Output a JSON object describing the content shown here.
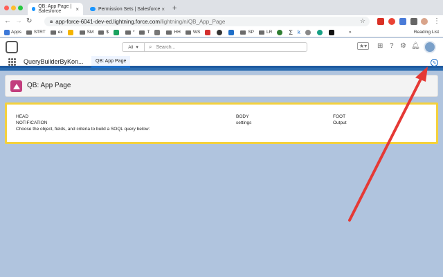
{
  "browser": {
    "tabs": [
      {
        "title": "QB: App Page | Salesforce",
        "active": true
      },
      {
        "title": "Permission Sets | Salesforce",
        "active": false
      }
    ],
    "url_host": "app-force-6041-dev-ed.lightning.force.com",
    "url_path": "/lightning/n/QB_App_Page",
    "bookmarks": [
      "Apps",
      "STRT",
      "ex",
      "SM",
      "$",
      "*",
      "T",
      "HH",
      "WS",
      "SP",
      "LR",
      "Σ",
      "k",
      "»"
    ],
    "reading_list": "Reading List"
  },
  "sf": {
    "search_scope": "All",
    "search_placeholder": "Search...",
    "app_name": "QueryBuilderByKon...",
    "nav_tab": "QB: App Page",
    "page_title": "QB: App Page"
  },
  "content": {
    "head": "HEAD",
    "notification": "NOTIFICATION",
    "instruction": "Choose the object, fields, and criteria to build a SOQL query below:",
    "body": "BODY",
    "settings": "settings",
    "foot": "FOOT",
    "output": "Output"
  },
  "colors": {
    "annotation_arrow": "#e53935",
    "page_icon": "#c23e7e",
    "card_border": "#f4d13d",
    "background": "#b0c4de"
  }
}
